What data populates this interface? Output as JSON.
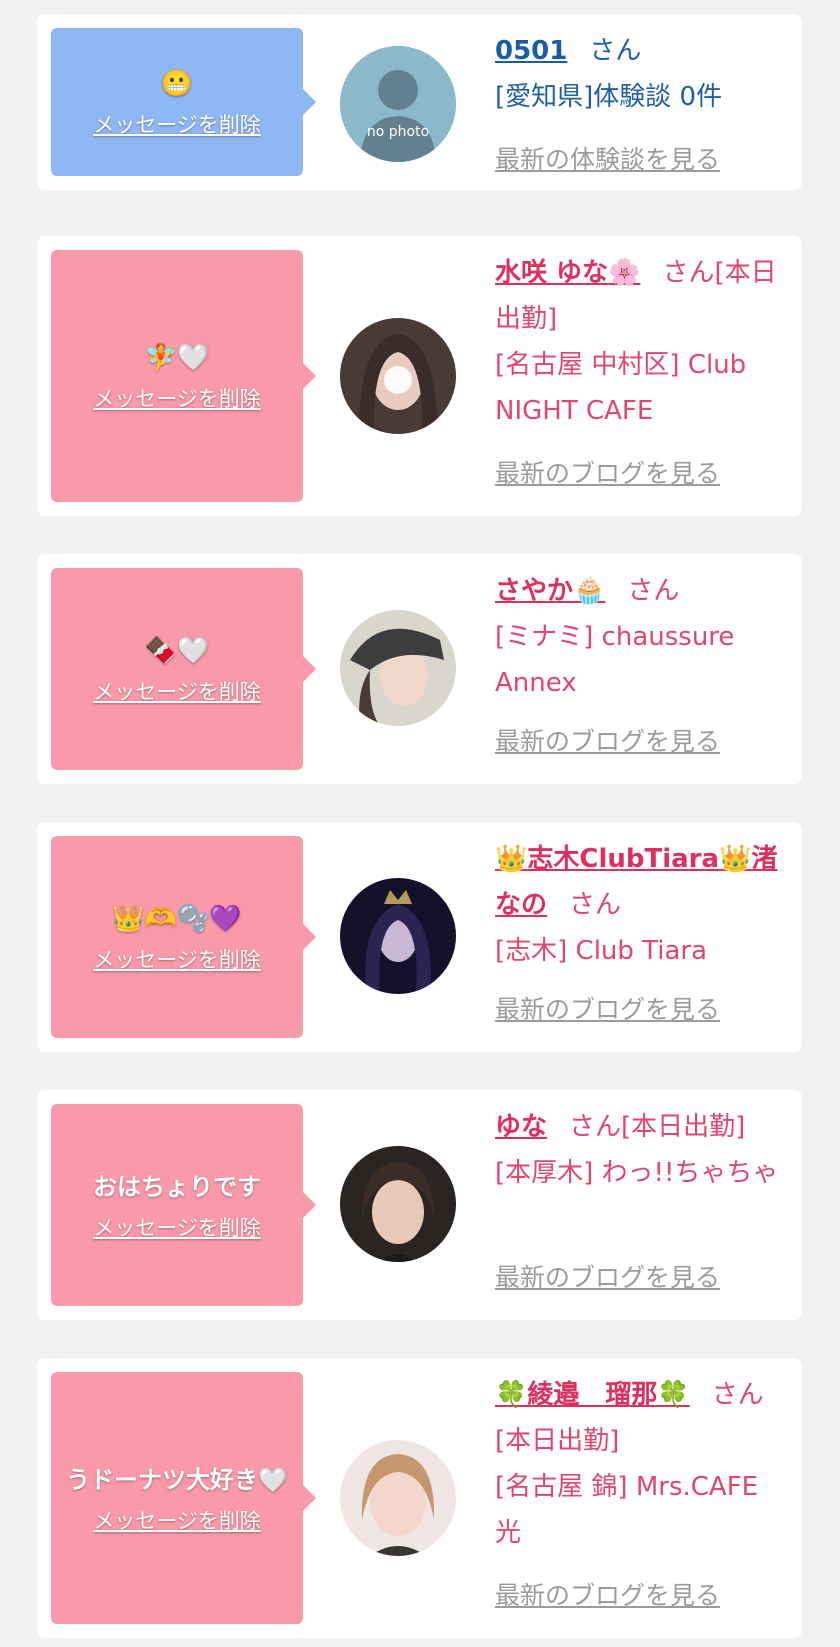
{
  "delete_label": "メッセージを削除",
  "san": "さん",
  "cards": [
    {
      "message": "😬",
      "name": "0501",
      "status": "",
      "location": "[愛知県]体験談 0件",
      "latest": "最新の体験談を見る",
      "avatar_text": "no photo",
      "theme": "blue"
    },
    {
      "message": "🧚🤍",
      "name": "水咲 ゆな🌸",
      "status": "[本日出勤]",
      "location": "[名古屋 中村区] Club NIGHT CAFE",
      "latest": "最新のブログを見る",
      "theme": "pink"
    },
    {
      "message": "🍫🤍",
      "name": "さやか🧁",
      "status": "",
      "location": "[ミナミ] chaussure Annex",
      "latest": "最新のブログを見る",
      "theme": "pink"
    },
    {
      "message": "👑🫶🫧💜",
      "name": "👑志木ClubTiara👑渚なの",
      "status": "",
      "location": "[志木] Club Tiara",
      "latest": "最新のブログを見る",
      "theme": "pink"
    },
    {
      "message": "おはちょりです",
      "name": "ゆな",
      "status": "[本日出勤]",
      "location": "[本厚木] わっ!!ちゃちゃ",
      "latest": "最新のブログを見る",
      "theme": "pink"
    },
    {
      "message": "うドーナツ大好き🤍",
      "name": "🍀綾邉　瑠那🍀",
      "status": "[本日出勤]",
      "location": "[名古屋 錦] Mrs.CAFE 光",
      "latest": "最新のブログを見る",
      "theme": "pink"
    }
  ],
  "colors": {
    "page_bg": "#f2f2f2",
    "bubble_blue": "#8fb7f3",
    "bubble_pink": "#f999a9",
    "name_pink": "#df2f5f",
    "name_blue": "#1a5aa6",
    "link_gray": "#9b9b9b"
  }
}
